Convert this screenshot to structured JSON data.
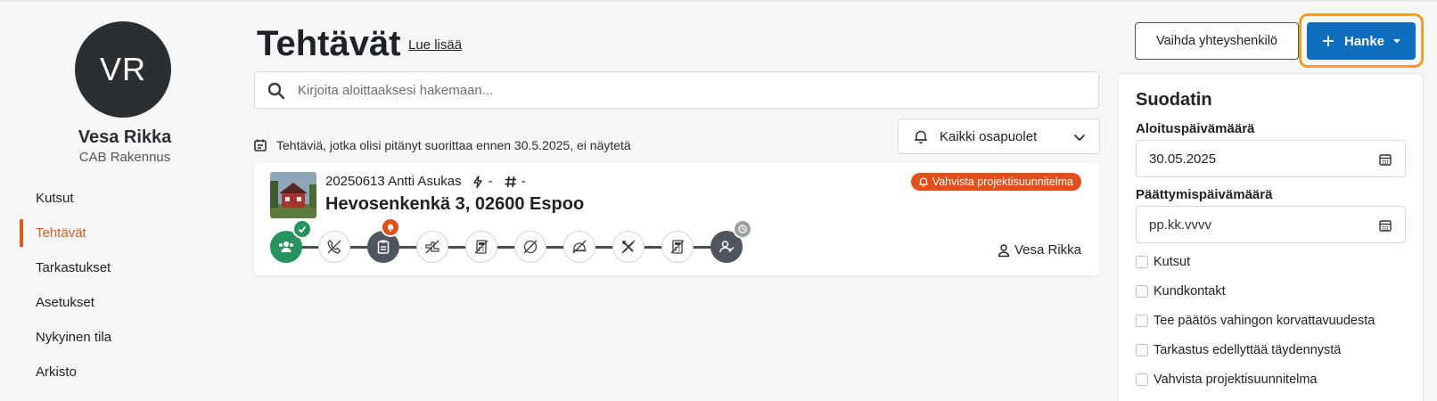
{
  "user": {
    "initials": "VR",
    "name": "Vesa Rikka",
    "company": "CAB Rakennus"
  },
  "nav": {
    "items": [
      {
        "label": "Kutsut",
        "active": false
      },
      {
        "label": "Tehtävät",
        "active": true
      },
      {
        "label": "Tarkastukset",
        "active": false
      },
      {
        "label": "Asetukset",
        "active": false
      },
      {
        "label": "Nykyinen tila",
        "active": false
      },
      {
        "label": "Arkisto",
        "active": false
      }
    ]
  },
  "header": {
    "title": "Tehtävät",
    "read_more": "Lue lisää",
    "change_contact_label": "Vaihda yhteyshenkilö",
    "hanke_label": "Hanke"
  },
  "search": {
    "placeholder": "Kirjoita aloittaaksesi hakemaan...",
    "value": ""
  },
  "notice": {
    "text": "Tehtäviä, jotka olisi pitänyt suorittaa ennen 30.5.2025, ei näytetä"
  },
  "party_filter": {
    "selected": "Kaikki osapuolet"
  },
  "task": {
    "id_owner": "20250613 Antti Asukas",
    "power_value": "-",
    "number_value": "-",
    "address": "Hevosenkenkä 3, 02600 Espoo",
    "badge": "Vahvista projektisuunnitelma",
    "assignee": "Vesa Rikka",
    "steps": [
      {
        "icon": "group-icon",
        "state": "done"
      },
      {
        "icon": "phone-off-icon",
        "state": "pending"
      },
      {
        "icon": "clipboard-icon",
        "state": "active-alert"
      },
      {
        "icon": "pipe-off-icon",
        "state": "pending"
      },
      {
        "icon": "calculator-off-icon",
        "state": "pending"
      },
      {
        "icon": "gauge-off-icon",
        "state": "pending"
      },
      {
        "icon": "helmet-off-icon",
        "state": "pending"
      },
      {
        "icon": "tools-off-icon",
        "state": "pending"
      },
      {
        "icon": "calculator-off-icon",
        "state": "pending"
      },
      {
        "icon": "user-check-icon",
        "state": "waiting"
      }
    ]
  },
  "filter": {
    "title": "Suodatin",
    "start_label": "Aloituspäivämäärä",
    "start_value": "30.05.2025",
    "end_label": "Päättymispäivämäärä",
    "end_placeholder": "pp.kk.vvvv",
    "options": [
      {
        "label": "Kutsut",
        "checked": false
      },
      {
        "label": "Kundkontakt",
        "checked": false
      },
      {
        "label": "Tee päätös vahingon korvattavuudesta",
        "checked": false
      },
      {
        "label": "Tarkastus edellyttää täydennystä",
        "checked": false
      },
      {
        "label": "Vahvista projektisuunnitelma",
        "checked": false
      }
    ]
  },
  "colors": {
    "accent": "#e25b1d",
    "primary": "#0d6ec0",
    "success": "#27935f",
    "focus": "#f0a020",
    "dark": "#2b2f32"
  }
}
